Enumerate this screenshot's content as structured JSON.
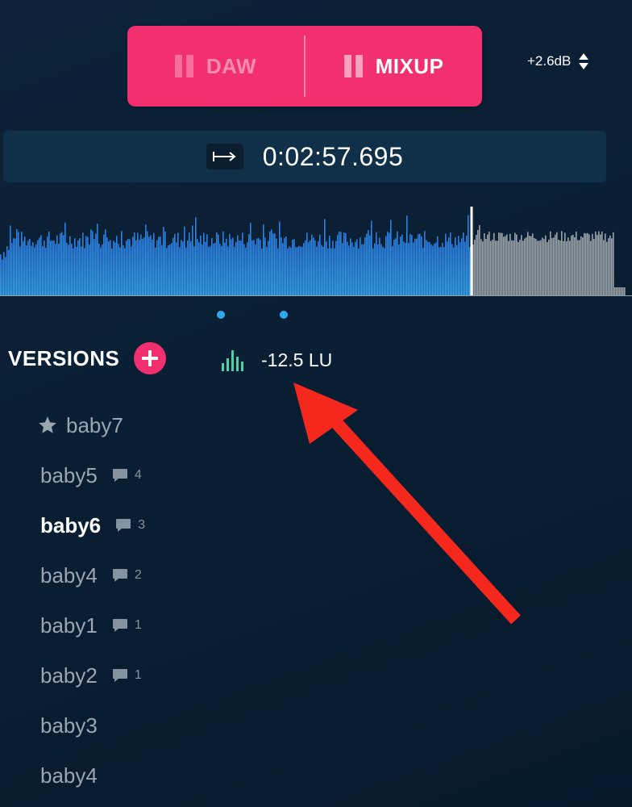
{
  "modes": {
    "daw_label": "DAW",
    "mixup_label": "MIXUP",
    "active": "mixup"
  },
  "gain": {
    "value": "+2.6dB"
  },
  "transport": {
    "time": "0:02:57.695",
    "goto_icon": "arrow-to-right-icon"
  },
  "waveform": {
    "played_color": "#2e8be8",
    "remaining_color": "#9aa3a9",
    "playhead_fraction": 0.746
  },
  "versions": {
    "title": "VERSIONS",
    "add_icon": "plus-icon",
    "loudness": "-12.5 LU",
    "items": [
      {
        "name": "baby7",
        "starred": true,
        "comments": ""
      },
      {
        "name": "baby5",
        "starred": false,
        "comments": "4"
      },
      {
        "name": "baby6",
        "starred": false,
        "comments": "3",
        "active": true
      },
      {
        "name": "baby4",
        "starred": false,
        "comments": "2"
      },
      {
        "name": "baby1",
        "starred": false,
        "comments": "1"
      },
      {
        "name": "baby2",
        "starred": false,
        "comments": "1"
      },
      {
        "name": "baby3",
        "starred": false,
        "comments": ""
      },
      {
        "name": "baby4",
        "starred": false,
        "comments": ""
      }
    ]
  },
  "colors": {
    "accent": "#f2306f",
    "annotation": "#f5281e",
    "loudness_icon": "#4fd1a5",
    "dot": "#2eaaf0"
  }
}
